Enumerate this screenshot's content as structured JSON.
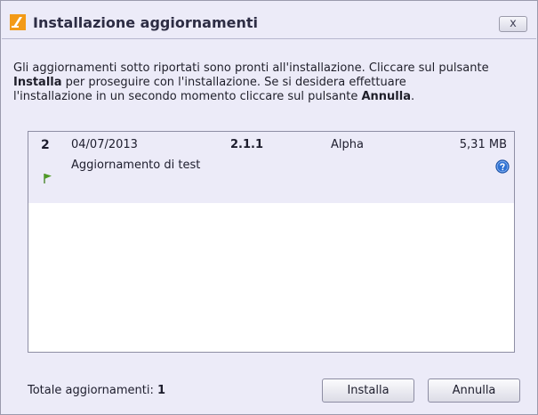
{
  "window": {
    "title": "Installazione aggiornamenti",
    "close_label": "x"
  },
  "description": {
    "line1": "Gli aggiornamenti sotto riportati sono pronti all'installazione. Cliccare sul pulsante",
    "line2_bold": "Installa",
    "line2_rest": " per proseguire con l'installazione. Se si desidera effettuare",
    "line3_start": "l'installazione in un secondo momento cliccare sul pulsante ",
    "line3_bold": "Annulla",
    "line3_end": "."
  },
  "updates": [
    {
      "number": "2",
      "date": "04/07/2013",
      "version": "2.1.1",
      "channel": "Alpha",
      "size": "5,31 MB",
      "name": "Aggiornamento di test",
      "flag_color": "#4f9a26"
    }
  ],
  "footer": {
    "total_label": "Totale aggiornamenti:",
    "total_value": "1",
    "install_button": "Installa",
    "cancel_button": "Annulla"
  },
  "colors": {
    "window_bg": "#ecebf8",
    "list_bg": "#ffffff",
    "row_bg": "#ecebf8",
    "icon_orange": "#f39a16",
    "info_blue": "#2f72d3"
  },
  "icons": {
    "app": "app-logo-icon",
    "flag": "flag-icon",
    "info": "info-icon",
    "close": "close-icon"
  }
}
